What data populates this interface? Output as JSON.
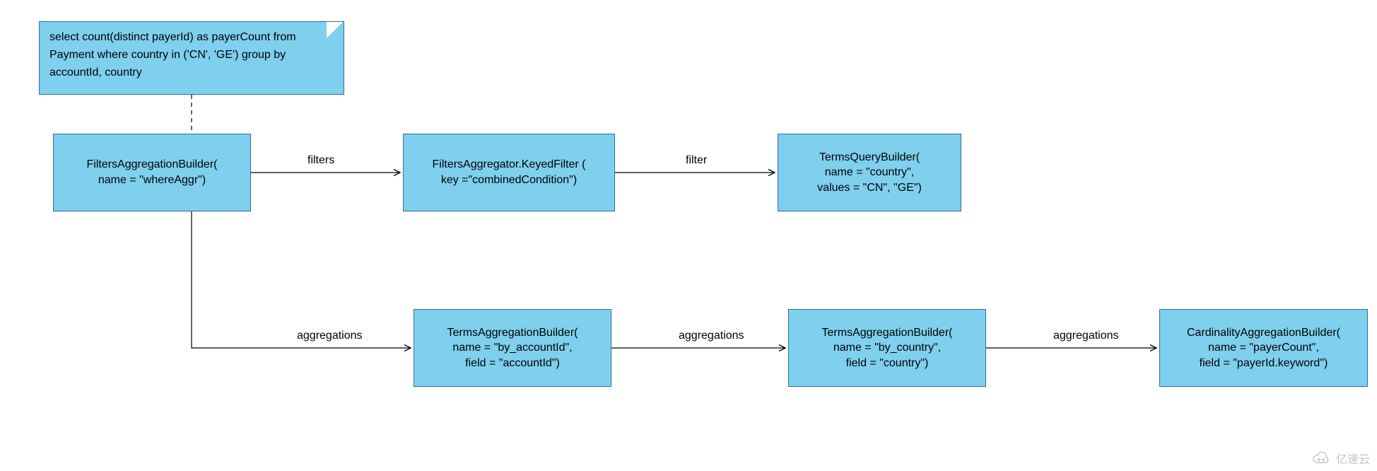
{
  "note": {
    "text": "select count(distinct payerId) as payerCount from Payment where country in ('CN', 'GE') group by accountId, country"
  },
  "nodes": {
    "filtersAggBuilder": {
      "line1": "FiltersAggregationBuilder(",
      "line2": "name = \"whereAggr\")"
    },
    "keyedFilter": {
      "line1": "FiltersAggregator.KeyedFilter (",
      "line2": "key =\"combinedCondition\")"
    },
    "termsQuery": {
      "line1": "TermsQueryBuilder(",
      "line2": "name = \"country\",",
      "line3": "values = \"CN\", \"GE\")"
    },
    "termsAggAccount": {
      "line1": "TermsAggregationBuilder(",
      "line2": "name = \"by_accountId\",",
      "line3": "field = \"accountId\")"
    },
    "termsAggCountry": {
      "line1": "TermsAggregationBuilder(",
      "line2": "name = \"by_country\",",
      "line3": "field = \"country\")"
    },
    "cardinalityAgg": {
      "line1": "CardinalityAggregationBuilder(",
      "line2": "name = \"payerCount\",",
      "line3": "field = \"payerId.keyword\")"
    }
  },
  "edges": {
    "filters": "filters",
    "filter": "filter",
    "aggregations1": "aggregations",
    "aggregations2": "aggregations",
    "aggregations3": "aggregations"
  },
  "watermark": "亿速云"
}
